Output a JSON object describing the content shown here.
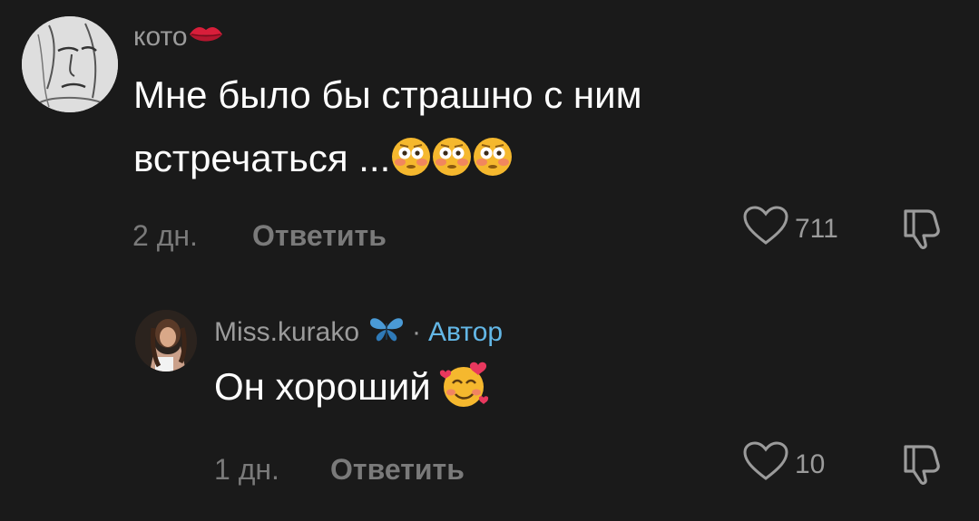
{
  "comments": [
    {
      "username": "кото",
      "username_icon": "lips-icon",
      "text_line1": "Мне было бы страшно с ним",
      "text_line2": "встречаться ...",
      "text_emojis": [
        "flushed-face-icon",
        "flushed-face-icon",
        "flushed-face-icon"
      ],
      "time": "2 дн.",
      "reply_label": "Ответить",
      "likes": "711"
    },
    {
      "username": "Miss.kurako",
      "username_icon": "butterfly-icon",
      "separator": "·",
      "author_badge": "Автор",
      "text": "Он хороший",
      "text_emoji": "smiling-face-with-hearts-icon",
      "time": "1 дн.",
      "reply_label": "Ответить",
      "likes": "10"
    }
  ],
  "colors": {
    "background": "#1a1a1a",
    "primary_text": "#ffffff",
    "secondary_text": "#9b9b9b",
    "author_badge": "#63b7e6"
  }
}
